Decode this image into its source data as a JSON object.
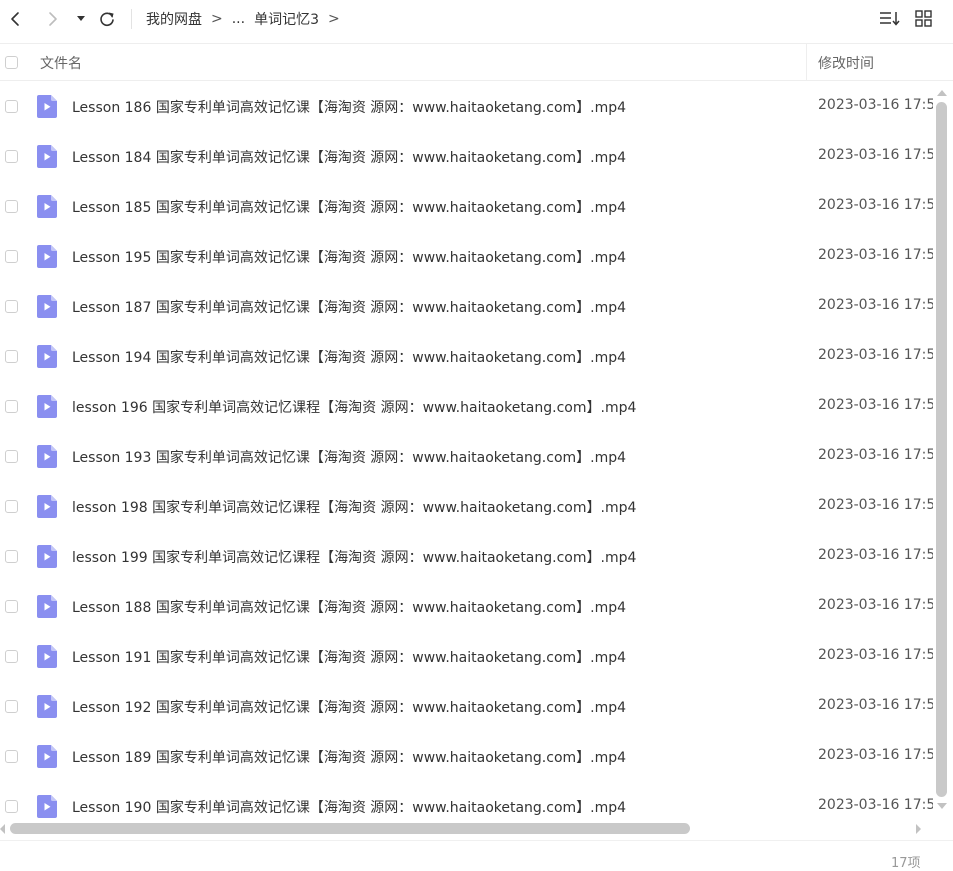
{
  "toolbar": {
    "back_icon": "chevron-left-icon",
    "forward_icon": "chevron-right-icon",
    "history_icon": "caret-down-icon",
    "refresh_icon": "refresh-icon",
    "sort_icon": "sort-icon",
    "view_icon": "grid-view-icon"
  },
  "breadcrumb": {
    "root": "我的网盘",
    "separator": ">",
    "ellipsis": "...",
    "current": "单词记忆3",
    "trailing_separator": ">"
  },
  "header": {
    "name": "文件名",
    "modified": "修改时间"
  },
  "files": [
    {
      "name": "Lesson 186 国家专利单词高效记忆课【海淘资 源网：www.haitaoketang.com】.mp4",
      "modified": "2023-03-16 17:5"
    },
    {
      "name": "Lesson 184 国家专利单词高效记忆课【海淘资 源网：www.haitaoketang.com】.mp4",
      "modified": "2023-03-16 17:5"
    },
    {
      "name": "Lesson 185 国家专利单词高效记忆课【海淘资 源网：www.haitaoketang.com】.mp4",
      "modified": "2023-03-16 17:5"
    },
    {
      "name": "Lesson 195 国家专利单词高效记忆课【海淘资 源网：www.haitaoketang.com】.mp4",
      "modified": "2023-03-16 17:5"
    },
    {
      "name": "Lesson 187 国家专利单词高效记忆课【海淘资 源网：www.haitaoketang.com】.mp4",
      "modified": "2023-03-16 17:5"
    },
    {
      "name": "Lesson 194 国家专利单词高效记忆课【海淘资 源网：www.haitaoketang.com】.mp4",
      "modified": "2023-03-16 17:5"
    },
    {
      "name": "lesson 196 国家专利单词高效记忆课程【海淘资 源网：www.haitaoketang.com】.mp4",
      "modified": "2023-03-16 17:5"
    },
    {
      "name": "Lesson 193 国家专利单词高效记忆课【海淘资 源网：www.haitaoketang.com】.mp4",
      "modified": "2023-03-16 17:5"
    },
    {
      "name": "lesson 198 国家专利单词高效记忆课程【海淘资 源网：www.haitaoketang.com】.mp4",
      "modified": "2023-03-16 17:5"
    },
    {
      "name": "lesson 199 国家专利单词高效记忆课程【海淘资 源网：www.haitaoketang.com】.mp4",
      "modified": "2023-03-16 17:5"
    },
    {
      "name": "Lesson 188 国家专利单词高效记忆课【海淘资 源网：www.haitaoketang.com】.mp4",
      "modified": "2023-03-16 17:5"
    },
    {
      "name": "Lesson 191 国家专利单词高效记忆课【海淘资 源网：www.haitaoketang.com】.mp4",
      "modified": "2023-03-16 17:5"
    },
    {
      "name": "Lesson 192 国家专利单词高效记忆课【海淘资 源网：www.haitaoketang.com】.mp4",
      "modified": "2023-03-16 17:5"
    },
    {
      "name": "Lesson 189 国家专利单词高效记忆课【海淘资 源网：www.haitaoketang.com】.mp4",
      "modified": "2023-03-16 17:5"
    },
    {
      "name": "Lesson 190 国家专利单词高效记忆课【海淘资 源网：www.haitaoketang.com】.mp4",
      "modified": "2023-03-16 17:5"
    }
  ],
  "file_icon": "video-file-icon",
  "colors": {
    "file_icon": "#8a8ff0",
    "file_icon_fold": "#c4c7f7"
  },
  "status": {
    "count": "17项"
  }
}
